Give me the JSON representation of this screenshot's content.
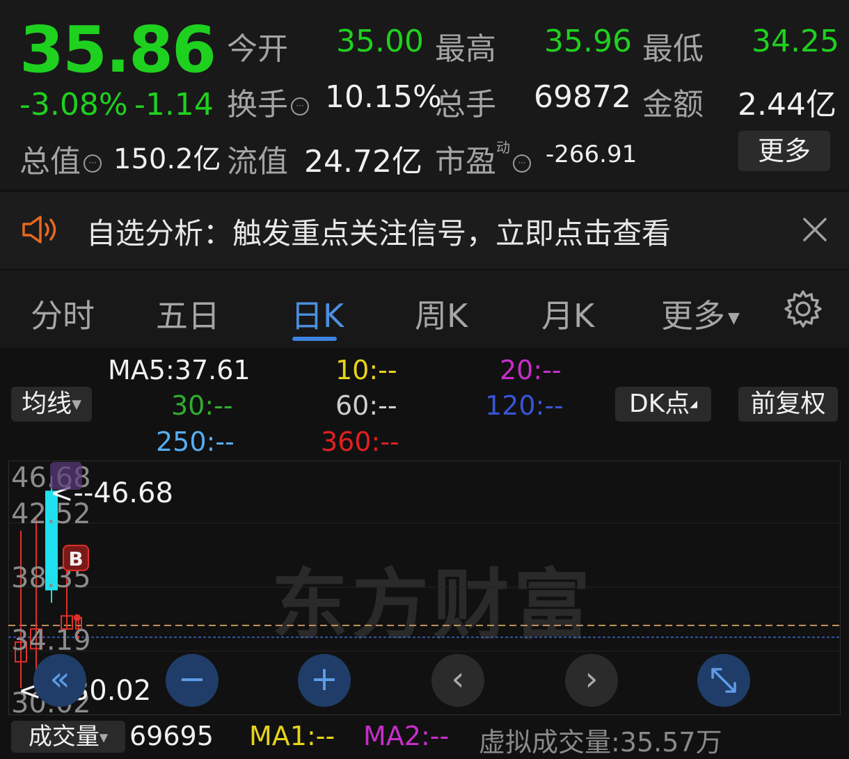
{
  "quote": {
    "price": "35.86",
    "change_pct": "-3.08%",
    "change_abs": "-1.14",
    "open_label": "今开",
    "open_value": "35.00",
    "high_label": "最高",
    "high_value": "35.96",
    "low_label": "最低",
    "low_value": "34.25",
    "turnover_label": "换手",
    "turnover_value": "10.15%",
    "volume_label": "总手",
    "volume_value": "69872",
    "amount_label": "金额",
    "amount_value": "2.44亿",
    "mktcap_label": "总值",
    "mktcap_value": "150.2亿",
    "float_label": "流值",
    "float_value": "24.72亿",
    "pe_label": "市盈",
    "pe_sup": "动",
    "pe_value": "-266.91",
    "more_label": "更多"
  },
  "notice": {
    "text": "自选分析：触发重点关注信号，立即点击查看",
    "close_icon": "close-icon"
  },
  "tabs": [
    {
      "label": "分时"
    },
    {
      "label": "五日"
    },
    {
      "label": "日K"
    },
    {
      "label": "周K"
    },
    {
      "label": "月K"
    },
    {
      "label": "更多"
    }
  ],
  "ma": {
    "ma5": "MA5:37.61",
    "ma10": "10:--",
    "ma20": "20:--",
    "ma30": "30:--",
    "ma60": "60:--",
    "ma120": "120:--",
    "ma250": "250:--",
    "ma360": "360:--",
    "selector": "均线",
    "dk": "DK点",
    "adjust": "前复权"
  },
  "colors": {
    "ma5": "#f0f0f0",
    "ma10": "#e8d31c",
    "ma20": "#c72ec9",
    "ma30": "#2fae2f",
    "ma60": "#cfcfcf",
    "ma120": "#3a54d6",
    "ma250": "#55aef0",
    "ma360": "#e02020",
    "up": "#e0302a",
    "down": "#1fe0ee",
    "price_green": "#1fd11f",
    "accent": "#3a84e0"
  },
  "chart": {
    "y_ticks": [
      "46.68",
      "42.52",
      "38.35",
      "34.19",
      "30.02"
    ],
    "high_marker": "<--46.68",
    "low_marker": "<---30.02",
    "b_label": "B",
    "watermark": "东方财富"
  },
  "chart_data": {
    "type": "candlestick",
    "ylim": [
      30.02,
      46.68
    ],
    "candles": [
      {
        "open": 32.5,
        "close": 34.0,
        "high": 42.5,
        "low": 30.5
      },
      {
        "open": 33.5,
        "close": 35.0,
        "high": 43.5,
        "low": 31.5
      },
      {
        "open": 45.5,
        "close": 38.0,
        "high": 46.68,
        "low": 37.0
      },
      {
        "open": 35.0,
        "close": 36.0,
        "high": 40.0,
        "low": 35.0
      },
      {
        "open": 35.0,
        "close": 35.86,
        "high": 35.96,
        "low": 34.25
      }
    ]
  },
  "controls": {
    "zoom_out": "zoom-out-icon",
    "zoom_in": "zoom-in-icon",
    "prev": "chevron-left-icon",
    "next": "chevron-right-icon",
    "rewind": "rewind-icon",
    "expand": "expand-icon"
  },
  "volume": {
    "selector": "成交量",
    "value": "69695",
    "ma1": "MA1:--",
    "ma2": "MA2:--",
    "virtual": "虚拟成交量:35.57万"
  }
}
